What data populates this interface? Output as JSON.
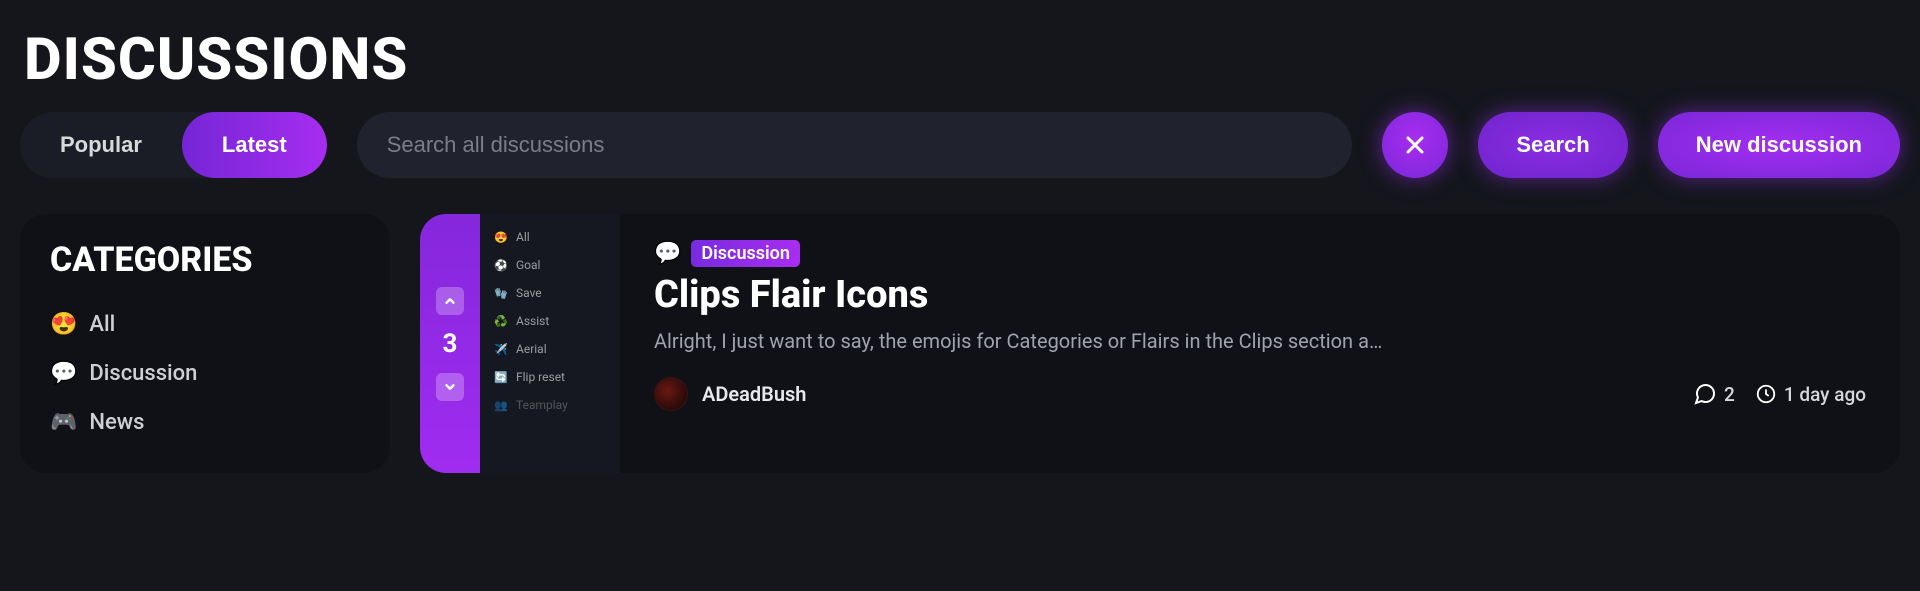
{
  "page": {
    "title": "DISCUSSIONS"
  },
  "toggle": {
    "popular": "Popular",
    "latest": "Latest",
    "active": "latest"
  },
  "search": {
    "placeholder": "Search all discussions"
  },
  "buttons": {
    "search": "Search",
    "new_discussion": "New discussion"
  },
  "sidebar": {
    "title": "CATEGORIES",
    "items": [
      {
        "emoji": "😍",
        "label": "All"
      },
      {
        "emoji": "💬",
        "label": "Discussion"
      },
      {
        "emoji": "🎮",
        "label": "News"
      }
    ]
  },
  "post": {
    "vote_count": "3",
    "mini_categories": [
      {
        "emoji": "😍",
        "label": "All"
      },
      {
        "emoji": "⚽",
        "label": "Goal"
      },
      {
        "emoji": "🧤",
        "label": "Save"
      },
      {
        "emoji": "♻️",
        "label": "Assist"
      },
      {
        "emoji": "✈️",
        "label": "Aerial"
      },
      {
        "emoji": "🔄",
        "label": "Flip reset"
      },
      {
        "emoji": "👥",
        "label": "Teamplay"
      }
    ],
    "flair_icon": "💬",
    "flair_label": "Discussion",
    "title": "Clips Flair Icons",
    "excerpt": "Alright, I just want to say, the emojis for Categories or Flairs in the Clips section a…",
    "author": "ADeadBush",
    "comments": "2",
    "time": "1 day ago"
  }
}
